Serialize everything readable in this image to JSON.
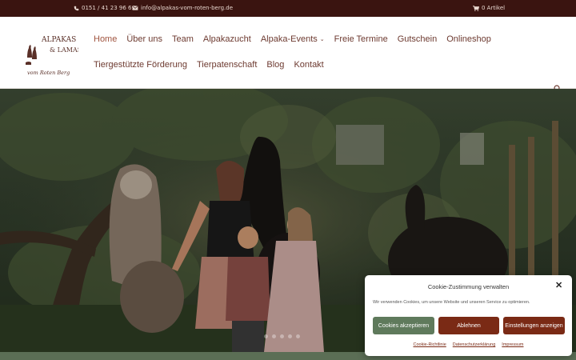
{
  "topbar": {
    "phone": "0151 / 41 23 96 69",
    "email": "info@alpakas-vom-roten-berg.de",
    "cart": "0 Artikel",
    "icons": [
      "phone-icon",
      "mail-icon",
      "cart-icon"
    ]
  },
  "logo": {
    "line1": "ALPAKAS",
    "line2": "& LAMAS",
    "line3": "vom Roten Berg"
  },
  "nav": {
    "row1": [
      "Home",
      "Über uns",
      "Team",
      "Alpakazucht",
      "Alpaka-Events",
      "Freie Termine",
      "Gutschein",
      "Onlineshop"
    ],
    "row2": [
      "Tiergestützte Förderung",
      "Tierpatenschaft",
      "Blog",
      "Kontakt"
    ],
    "active": "Home"
  },
  "cookie": {
    "title": "Cookie-Zustimmung verwalten",
    "text": "Wir verwenden Cookies, um unsere Website und unseren Service zu optimieren.",
    "accept": "Cookies akzeptieren",
    "deny": "Ablehnen",
    "settings": "Einstellungen anzeigen",
    "links": [
      "Cookie-Richtlinie",
      "Datenschutzerklärung",
      "Impressum"
    ]
  },
  "colors": {
    "topbar": "#3a1410",
    "nav_text": "#6d3a30",
    "accent": "#7a2a15",
    "accept_green": "#5f7a5c"
  }
}
